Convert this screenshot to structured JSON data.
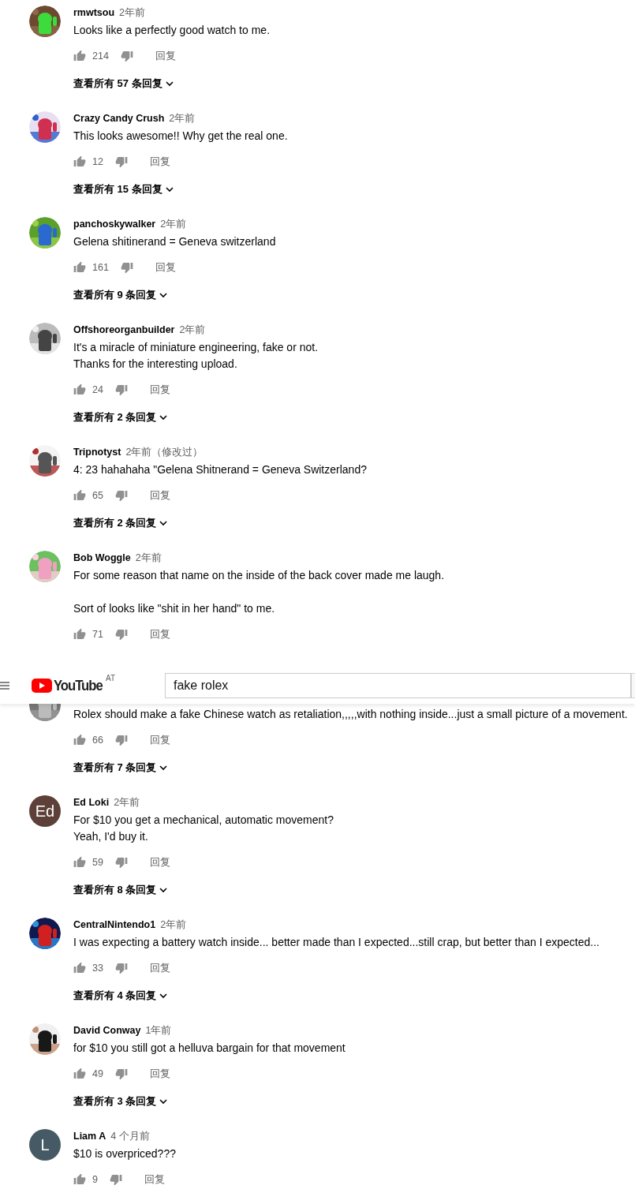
{
  "comments": [
    {
      "author": "rmwtsou",
      "time": "2年前",
      "text": "Looks like a perfectly good watch to me.",
      "likes": "214",
      "reply": "回复",
      "replies": "查看所有 57 条回复"
    },
    {
      "author": "Crazy Candy Crush",
      "time": "2年前",
      "text": "This looks awesome!! Why get the real one.",
      "likes": "12",
      "reply": "回复",
      "replies": "查看所有 15 条回复"
    },
    {
      "author": "panchoskywalker",
      "time": "2年前",
      "text": "Gelena shitinerand = Geneva switzerland",
      "likes": "161",
      "reply": "回复",
      "replies": "查看所有 9 条回复"
    },
    {
      "author": "Offshoreorganbuilder",
      "time": "2年前",
      "text": "It's a miracle of miniature engineering, fake or not.\nThanks for the interesting upload.",
      "likes": "24",
      "reply": "回复",
      "replies": "查看所有 2 条回复"
    },
    {
      "author": "Tripnotyst",
      "time": "2年前（修改过）",
      "text": "4: 23 hahahaha  \"Gelena Shitnerand = Geneva Switzerland?",
      "likes": "65",
      "reply": "回复",
      "replies": "查看所有 2 条回复"
    },
    {
      "author": "Bob Woggle",
      "time": "2年前",
      "text": "For some reason that name on the inside of the back cover made me laugh.\n\nSort of looks like \"shit in her hand\" to me.",
      "likes": "71",
      "reply": "回复"
    },
    {
      "text": "Rolex should make a fake Chinese watch as retaliation,,,,,with nothing inside...just a small picture of a movement.",
      "likes": "66",
      "reply": "回复",
      "replies": "查看所有 7 条回复"
    },
    {
      "avatar": {
        "kind": "letter",
        "text": "Ed",
        "color": "#5d4037"
      },
      "author": "Ed Loki",
      "time": "2年前",
      "text": "For $10 you get a mechanical, automatic movement?\nYeah, I'd buy it.",
      "likes": "59",
      "reply": "回复",
      "replies": "查看所有 8 条回复"
    },
    {
      "author": "CentralNintendo1",
      "time": "2年前",
      "text": "I was expecting a battery watch inside... better made than I expected...still crap, but better than I expected...",
      "likes": "33",
      "reply": "回复",
      "replies": "查看所有 4 条回复"
    },
    {
      "author": "David Conway",
      "time": "1年前",
      "text": "for $10 you still got a helluva  bargain for that movement",
      "likes": "49",
      "reply": "回复",
      "replies": "查看所有 3 条回复"
    },
    {
      "avatar": {
        "kind": "letter",
        "text": "L",
        "color": "#455a64"
      },
      "author": "Liam A",
      "time": "4 个月前",
      "text": "$10 is overpriced???",
      "likes": "9",
      "reply": "回复"
    }
  ],
  "masthead": {
    "logo": "YouTube",
    "region": "AT",
    "search": {
      "value": "fake rolex"
    }
  }
}
